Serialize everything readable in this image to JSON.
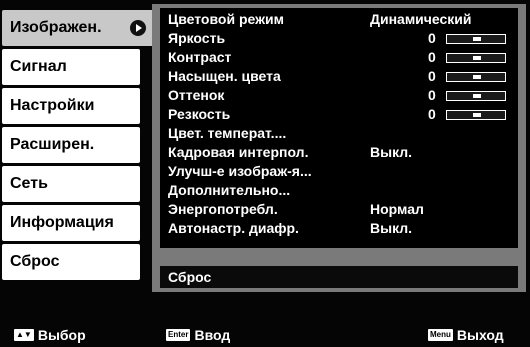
{
  "tabs": [
    {
      "label": "Изображен.",
      "active": true
    },
    {
      "label": "Сигнал"
    },
    {
      "label": "Настройки"
    },
    {
      "label": "Расширен."
    },
    {
      "label": "Сеть"
    },
    {
      "label": "Информация"
    },
    {
      "label": "Сброс"
    }
  ],
  "rows": [
    {
      "label": "Цветовой режим",
      "value": "Динамический"
    },
    {
      "label": "Яркость",
      "number": "0"
    },
    {
      "label": "Контраст",
      "number": "0"
    },
    {
      "label": "Насыщен. цвета",
      "number": "0"
    },
    {
      "label": "Оттенок",
      "number": "0"
    },
    {
      "label": "Резкость",
      "number": "0"
    },
    {
      "label": "Цвет. температ....",
      "value": ""
    },
    {
      "label": "Кадровая интерпол.",
      "value": "Выкл."
    },
    {
      "label": "Улучш-е изображ-я...",
      "value": ""
    },
    {
      "label": "Дополнительно...",
      "value": ""
    },
    {
      "label": "Энергопотребл.",
      "value": "Нормал"
    },
    {
      "label": "Автонастр. диафр.",
      "value": "Выкл."
    }
  ],
  "reset_label": "Сброс",
  "help": {
    "select_key": "▲▼",
    "select_label": "Выбор",
    "enter_key": "Enter",
    "enter_label": "Ввод",
    "menu_key": "Menu",
    "menu_label": "Выход"
  }
}
